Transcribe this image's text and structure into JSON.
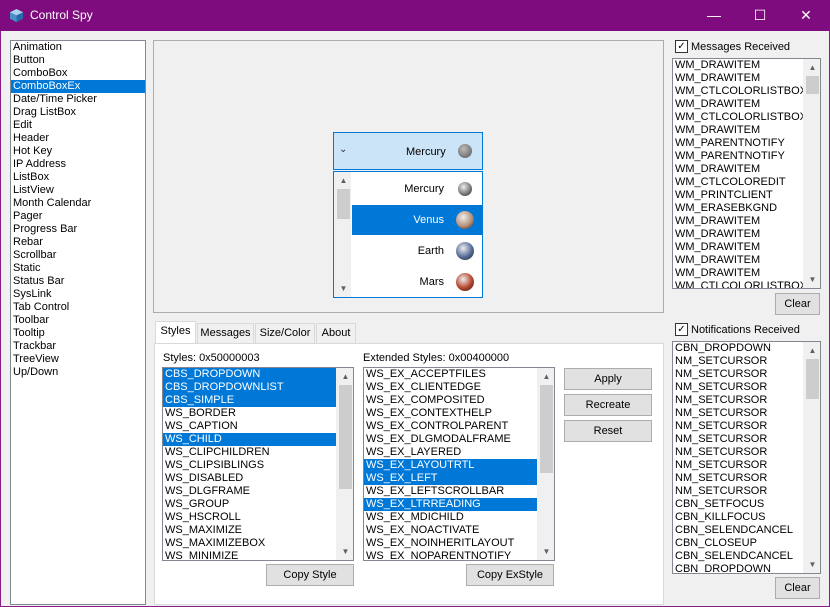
{
  "window": {
    "title": "Control Spy",
    "controls": {
      "minimize": "—",
      "maximize": "☐",
      "close": "✕"
    }
  },
  "controls_list": [
    "Animation",
    "Button",
    "ComboBox",
    "ComboBoxEx",
    "Date/Time Picker",
    "Drag ListBox",
    "Edit",
    "Header",
    "Hot Key",
    "IP Address",
    "ListBox",
    "ListView",
    "Month Calendar",
    "Pager",
    "Progress Bar",
    "Rebar",
    "Scrollbar",
    "Static",
    "Status Bar",
    "SysLink",
    "Tab Control",
    "Toolbar",
    "Tooltip",
    "Trackbar",
    "TreeView",
    "Up/Down"
  ],
  "controls_selected": "ComboBoxEx",
  "combo": {
    "selected": "Mercury",
    "items": [
      {
        "label": "Mercury",
        "selected": false,
        "color": "#7c7c7c"
      },
      {
        "label": "Venus",
        "selected": true,
        "color": "#b7927a"
      },
      {
        "label": "Earth",
        "selected": false,
        "color": "#556b99"
      },
      {
        "label": "Mars",
        "selected": false,
        "color": "#b5452b"
      }
    ]
  },
  "tabs": [
    {
      "label": "Styles",
      "active": true
    },
    {
      "label": "Messages",
      "active": false
    },
    {
      "label": "Size/Color",
      "active": false
    },
    {
      "label": "About",
      "active": false
    }
  ],
  "styles": {
    "label": "Styles: 0x50000003",
    "items": [
      {
        "label": "CBS_DROPDOWN",
        "sel": true
      },
      {
        "label": "CBS_DROPDOWNLIST",
        "sel": true
      },
      {
        "label": "CBS_SIMPLE",
        "sel": true
      },
      {
        "label": "WS_BORDER",
        "sel": false
      },
      {
        "label": "WS_CAPTION",
        "sel": false
      },
      {
        "label": "WS_CHILD",
        "sel": true
      },
      {
        "label": "WS_CLIPCHILDREN",
        "sel": false
      },
      {
        "label": "WS_CLIPSIBLINGS",
        "sel": false
      },
      {
        "label": "WS_DISABLED",
        "sel": false
      },
      {
        "label": "WS_DLGFRAME",
        "sel": false
      },
      {
        "label": "WS_GROUP",
        "sel": false
      },
      {
        "label": "WS_HSCROLL",
        "sel": false
      },
      {
        "label": "WS_MAXIMIZE",
        "sel": false
      },
      {
        "label": "WS_MAXIMIZEBOX",
        "sel": false
      },
      {
        "label": "WS_MINIMIZE",
        "sel": false
      }
    ],
    "copy_button": "Copy Style"
  },
  "ext_styles": {
    "label": "Extended Styles: 0x00400000",
    "items": [
      {
        "label": "WS_EX_ACCEPTFILES",
        "sel": false
      },
      {
        "label": "WS_EX_CLIENTEDGE",
        "sel": false
      },
      {
        "label": "WS_EX_COMPOSITED",
        "sel": false
      },
      {
        "label": "WS_EX_CONTEXTHELP",
        "sel": false
      },
      {
        "label": "WS_EX_CONTROLPARENT",
        "sel": false
      },
      {
        "label": "WS_EX_DLGMODALFRAME",
        "sel": false
      },
      {
        "label": "WS_EX_LAYERED",
        "sel": false
      },
      {
        "label": "WS_EX_LAYOUTRTL",
        "sel": true
      },
      {
        "label": "WS_EX_LEFT",
        "sel": true
      },
      {
        "label": "WS_EX_LEFTSCROLLBAR",
        "sel": false
      },
      {
        "label": "WS_EX_LTRREADING",
        "sel": true
      },
      {
        "label": "WS_EX_MDICHILD",
        "sel": false
      },
      {
        "label": "WS_EX_NOACTIVATE",
        "sel": false
      },
      {
        "label": "WS_EX_NOINHERITLAYOUT",
        "sel": false
      },
      {
        "label": "WS_EX_NOPARENTNOTIFY",
        "sel": false
      }
    ],
    "copy_button": "Copy ExStyle"
  },
  "actions": {
    "apply": "Apply",
    "recreate": "Recreate",
    "reset": "Reset"
  },
  "messages": {
    "checkbox_label": "Messages Received",
    "checked": true,
    "items": [
      "WM_DRAWITEM",
      "WM_DRAWITEM",
      "WM_CTLCOLORLISTBOX",
      "WM_DRAWITEM",
      "WM_CTLCOLORLISTBOX",
      "WM_DRAWITEM",
      "WM_PARENTNOTIFY",
      "WM_PARENTNOTIFY",
      "WM_DRAWITEM",
      "WM_CTLCOLOREDIT",
      "WM_PRINTCLIENT",
      "WM_ERASEBKGND",
      "WM_DRAWITEM",
      "WM_DRAWITEM",
      "WM_DRAWITEM",
      "WM_DRAWITEM",
      "WM_DRAWITEM",
      "WM_CTLCOLORLISTBOX"
    ],
    "clear": "Clear"
  },
  "notifications": {
    "checkbox_label": "Notifications Received",
    "checked": true,
    "items": [
      "CBN_DROPDOWN",
      "NM_SETCURSOR",
      "NM_SETCURSOR",
      "NM_SETCURSOR",
      "NM_SETCURSOR",
      "NM_SETCURSOR",
      "NM_SETCURSOR",
      "NM_SETCURSOR",
      "NM_SETCURSOR",
      "NM_SETCURSOR",
      "NM_SETCURSOR",
      "NM_SETCURSOR",
      "CBN_SETFOCUS",
      "CBN_KILLFOCUS",
      "CBN_SELENDCANCEL",
      "CBN_CLOSEUP",
      "CBN_SELENDCANCEL",
      "CBN_DROPDOWN"
    ],
    "clear": "Clear"
  },
  "colors": {
    "titlebar": "#7e0c7e",
    "selection": "#0078d7"
  }
}
